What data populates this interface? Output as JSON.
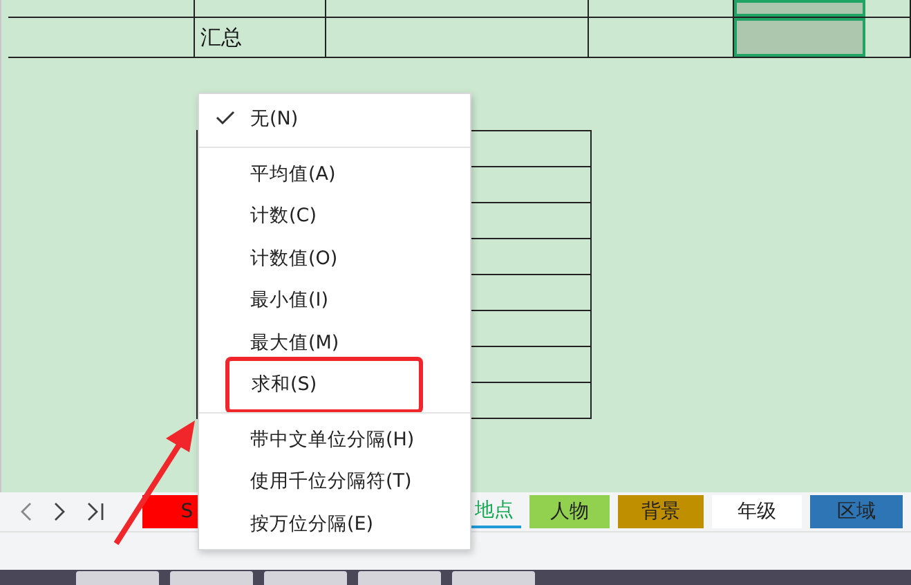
{
  "sheet": {
    "rows": [
      {
        "cells": [
          {
            "selected": false
          },
          {
            "selected": false
          },
          {
            "selected": false
          },
          {
            "selected": false
          },
          {
            "selected": true
          },
          {
            "selected": false
          }
        ]
      },
      {
        "cells": [
          {
            "selected": false
          },
          {
            "text": "汇总",
            "selected": false
          },
          {
            "selected": false
          },
          {
            "selected": false
          },
          {
            "selected": true
          },
          {
            "selected": false
          }
        ]
      }
    ]
  },
  "menu": {
    "sections": [
      [
        {
          "label": "无(N)",
          "checked": true,
          "annotated": false
        }
      ],
      [
        {
          "label": "平均值(A)",
          "checked": false,
          "annotated": false
        },
        {
          "label": "计数(C)",
          "checked": false,
          "annotated": false
        },
        {
          "label": "计数值(O)",
          "checked": false,
          "annotated": false
        },
        {
          "label": "最小值(I)",
          "checked": false,
          "annotated": false
        },
        {
          "label": "最大值(M)",
          "checked": false,
          "annotated": false
        },
        {
          "label": "求和(S)",
          "checked": false,
          "annotated": true
        }
      ],
      [
        {
          "label": "带中文单位分隔(H)",
          "checked": false,
          "annotated": false
        },
        {
          "label": "使用千位分隔符(T)",
          "checked": false,
          "annotated": false
        },
        {
          "label": "按万位分隔(E)",
          "checked": false,
          "annotated": false
        }
      ]
    ]
  },
  "sheet_tabs": [
    {
      "label": "S",
      "color": "#ff0000",
      "selected": false
    },
    {
      "label": "地点",
      "color": "#ffffff",
      "selected": true
    },
    {
      "label": "人物",
      "color": "#92d050",
      "selected": false
    },
    {
      "label": "背景",
      "color": "#bf8f00",
      "selected": false
    },
    {
      "label": "年级",
      "color": "#ffffff",
      "selected": false
    },
    {
      "label": "区域",
      "color": "#2e75b6",
      "selected": false
    }
  ]
}
